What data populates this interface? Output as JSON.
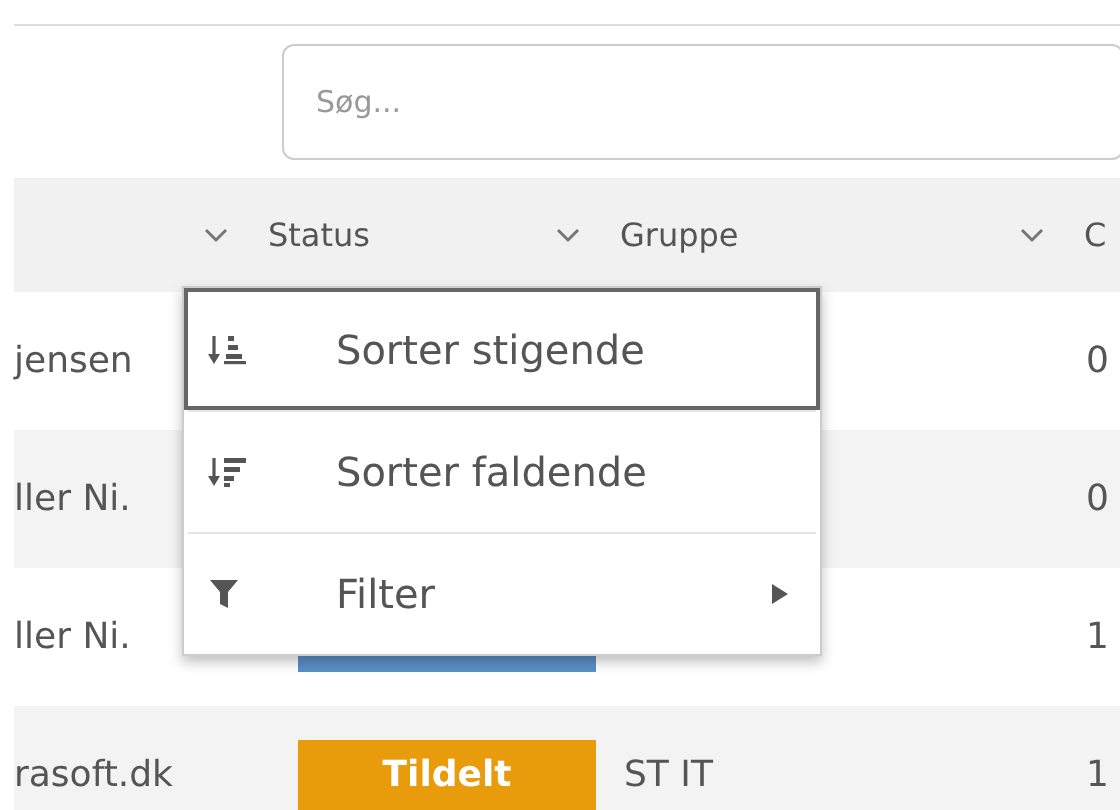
{
  "search": {
    "placeholder": "Søg..."
  },
  "table": {
    "columns": [
      {
        "label": "Status"
      },
      {
        "label": "Gruppe"
      },
      {
        "label": "C"
      }
    ],
    "rows": [
      {
        "column_1": "jensen",
        "column_4": "0"
      },
      {
        "column_1": "ller Ni.",
        "column_4": "0"
      },
      {
        "column_1": "ller Ni.",
        "status": {
          "color": "#5b8fc7"
        },
        "column_4": "1"
      },
      {
        "column_1": "rasoft.dk",
        "status": {
          "text": "Tildelt",
          "color": "#e89c0c"
        },
        "gruppe": "ST IT",
        "column_4": "1"
      }
    ]
  },
  "menu": {
    "items": [
      {
        "kind": "sort-asc",
        "label": "Sorter stigende",
        "selected": true
      },
      {
        "kind": "sort-desc",
        "label": "Sorter faldende",
        "selected": false
      },
      {
        "kind": "filter",
        "label": "Filter",
        "submenu": true
      }
    ]
  }
}
